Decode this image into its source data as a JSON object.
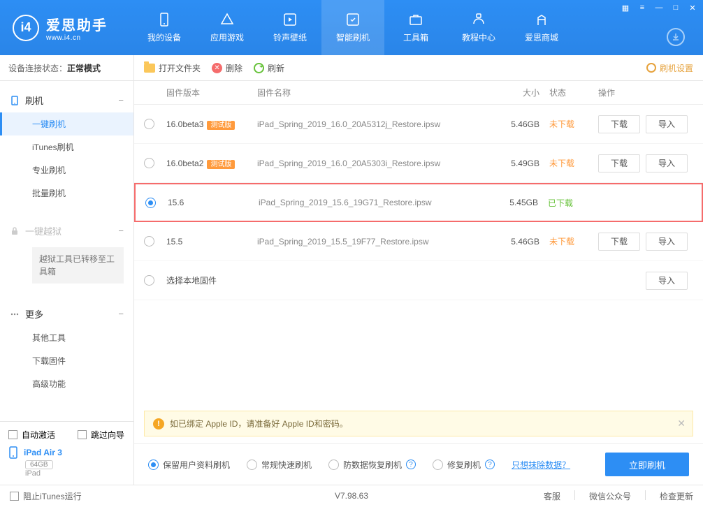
{
  "header": {
    "app_name": "爱思助手",
    "app_url": "www.i4.cn",
    "nav": [
      {
        "label": "我的设备"
      },
      {
        "label": "应用游戏"
      },
      {
        "label": "铃声壁纸"
      },
      {
        "label": "智能刷机"
      },
      {
        "label": "工具箱"
      },
      {
        "label": "教程中心"
      },
      {
        "label": "爱思商城"
      }
    ]
  },
  "sidebar": {
    "status_label": "设备连接状态：",
    "status_value": "正常模式",
    "group1": {
      "title": "刷机",
      "items": [
        "一键刷机",
        "iTunes刷机",
        "专业刷机",
        "批量刷机"
      ]
    },
    "group2": {
      "title": "一键越狱",
      "box": "越狱工具已转移至工具箱"
    },
    "group3": {
      "title": "更多",
      "items": [
        "其他工具",
        "下载固件",
        "高级功能"
      ]
    },
    "auto_activate": "自动激活",
    "skip_guide": "跳过向导",
    "device_name": "iPad Air 3",
    "storage": "64GB",
    "device_type": "iPad"
  },
  "toolbar": {
    "open_folder": "打开文件夹",
    "delete": "删除",
    "refresh": "刷新",
    "settings": "刷机设置"
  },
  "table": {
    "headers": {
      "version": "固件版本",
      "name": "固件名称",
      "size": "大小",
      "state": "状态",
      "ops": "操作"
    },
    "rows": [
      {
        "version": "16.0beta3",
        "beta": "测试版",
        "name": "iPad_Spring_2019_16.0_20A5312j_Restore.ipsw",
        "size": "5.46GB",
        "state": "未下载",
        "state_cls": "orange",
        "selected": false,
        "ops": true
      },
      {
        "version": "16.0beta2",
        "beta": "测试版",
        "name": "iPad_Spring_2019_16.0_20A5303i_Restore.ipsw",
        "size": "5.49GB",
        "state": "未下载",
        "state_cls": "orange",
        "selected": false,
        "ops": true
      },
      {
        "version": "15.6",
        "beta": "",
        "name": "iPad_Spring_2019_15.6_19G71_Restore.ipsw",
        "size": "5.45GB",
        "state": "已下载",
        "state_cls": "green",
        "selected": true,
        "ops": false,
        "highlight": true
      },
      {
        "version": "15.5",
        "beta": "",
        "name": "iPad_Spring_2019_15.5_19F77_Restore.ipsw",
        "size": "5.46GB",
        "state": "未下载",
        "state_cls": "orange",
        "selected": false,
        "ops": true
      }
    ],
    "local_row": "选择本地固件",
    "download_btn": "下载",
    "import_btn": "导入"
  },
  "notice": "如已绑定 Apple ID，请准备好 Apple ID和密码。",
  "options": {
    "opt1": "保留用户资料刷机",
    "opt2": "常规快速刷机",
    "opt3": "防数据恢复刷机",
    "opt4": "修复刷机",
    "link": "只想抹除数据？",
    "flash": "立即刷机"
  },
  "footer": {
    "block_itunes": "阻止iTunes运行",
    "version": "V7.98.63",
    "links": [
      "客服",
      "微信公众号",
      "检查更新"
    ]
  }
}
